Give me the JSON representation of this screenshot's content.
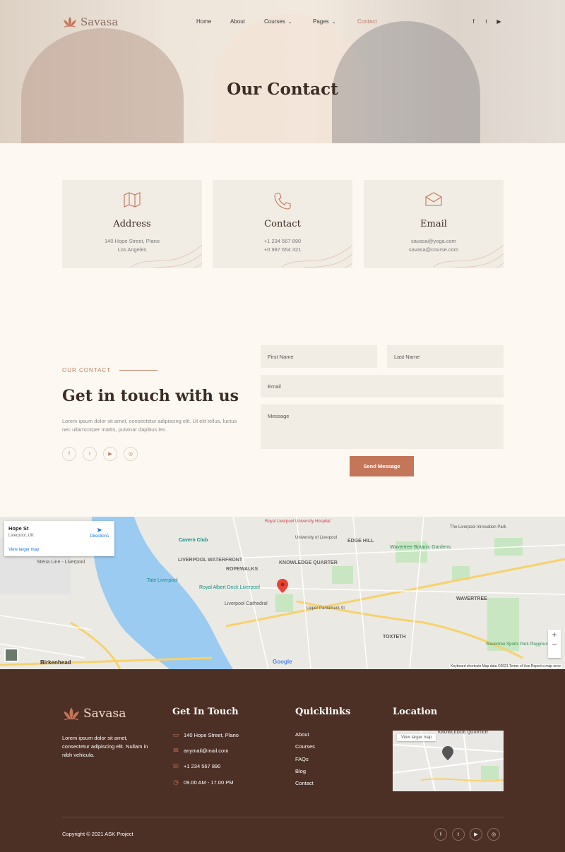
{
  "brand": {
    "name": "Savasa"
  },
  "nav": {
    "items": [
      {
        "label": "Home"
      },
      {
        "label": "About"
      },
      {
        "label": "Courses"
      },
      {
        "label": "Pages"
      },
      {
        "label": "Contact"
      }
    ],
    "social": [
      "facebook-icon",
      "twitter-icon",
      "youtube-icon"
    ]
  },
  "hero": {
    "title": "Our Contact"
  },
  "cards": [
    {
      "icon": "map-icon",
      "title": "Address",
      "line1": "140 Hope Street, Plano",
      "line2": "Los Angeles"
    },
    {
      "icon": "phone-icon",
      "title": "Contact",
      "line1": "+1 234 567 890",
      "line2": "+0 987 654 321"
    },
    {
      "icon": "envelope-icon",
      "title": "Email",
      "line1": "savasa@yoga.com",
      "line2": "savasa@course.com"
    }
  ],
  "contact": {
    "eyebrow": "OUR CONTACT",
    "heading": "Get in touch with us",
    "description": "Lorem ipsum dolor sit amet, consectetur adipiscing elit. Ut elit tellus, luctus nec ullamcorper mattis, pulvinar dapibus leo.",
    "social": [
      "facebook-icon",
      "twitter-icon",
      "youtube-icon",
      "instagram-icon"
    ],
    "form": {
      "first_name": "First Name",
      "last_name": "Last Name",
      "email": "Email",
      "message": "Message",
      "submit": "Send Message"
    }
  },
  "map": {
    "place_title": "Hope St",
    "place_sub": "Liverpool, UK",
    "larger_link": "View larger map",
    "directions": "Directions",
    "labels": [
      "Cavern Club",
      "LIVERPOOL WATERFRONT",
      "ROPEWALKS",
      "KNOWLEDGE QUARTER",
      "EDGE HILL",
      "Wavertree Botanic Gardens",
      "Tate Liverpool",
      "Royal Albert Dock Liverpool",
      "Liverpool Cathedral",
      "WAVERTREE",
      "TOXTETH",
      "Birkenhead",
      "Stena Line - Liverpool",
      "Upper Parliament St",
      "The Liverpool Innovation Park",
      "Wavertree Sports Park Playground",
      "University of Liverpool",
      "Royal Liverpool University Hospital"
    ],
    "footer_text": "Keyboard shortcuts   Map data ©2021   Terms of Use   Report a map error",
    "google": "Google"
  },
  "footer": {
    "description": "Lorem ipsum dolor sit amet, consectetur adipiscing elit. Nullam in nibh vehicula.",
    "get_in_touch_title": "Get In Touch",
    "contacts": [
      {
        "icon": "map-icon",
        "text": "140 Hope Street, Plano"
      },
      {
        "icon": "envelope-icon",
        "text": "anymail@mail.com"
      },
      {
        "icon": "phone-icon",
        "text": "+1 234 567 890"
      },
      {
        "icon": "clock-icon",
        "text": "09.00 AM - 17.00 PM"
      }
    ],
    "quicklinks_title": "Quicklinks",
    "links": [
      {
        "label": "About"
      },
      {
        "label": "Courses"
      },
      {
        "label": "FAQs"
      },
      {
        "label": "Blog"
      },
      {
        "label": "Contact"
      }
    ],
    "location_title": "Location",
    "minimap_link": "View larger map",
    "minimap_label": "KNOWLEDGE QUARTER",
    "copyright": "Copyright © 2021 ASK Project",
    "social": [
      "facebook-icon",
      "twitter-icon",
      "youtube-icon",
      "instagram-icon"
    ]
  },
  "colors": {
    "accent": "#c4765a",
    "footer_bg": "#4c2f25",
    "page_bg": "#fdf9f2",
    "card_bg": "#f1ece4"
  }
}
